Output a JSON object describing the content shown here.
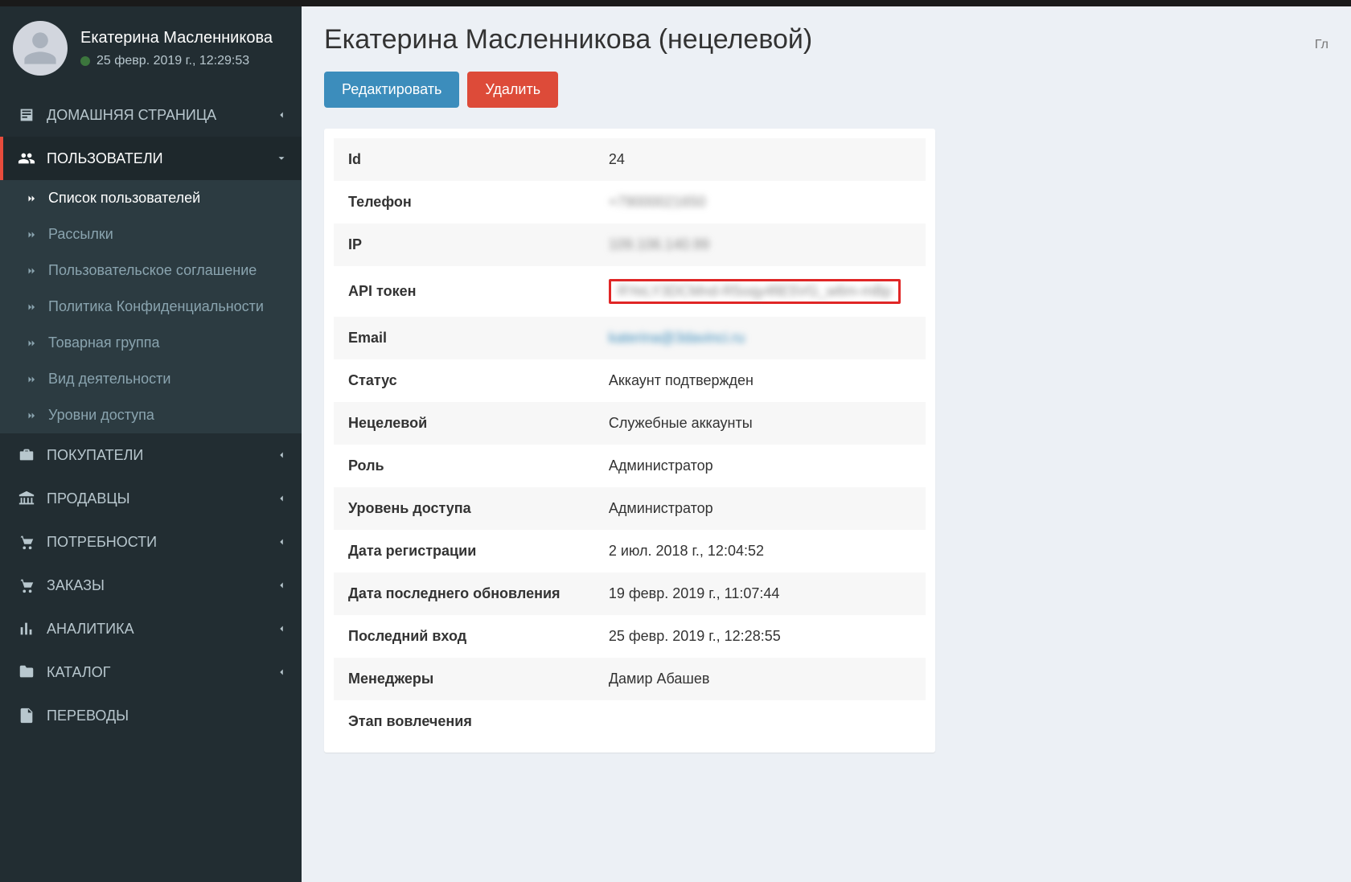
{
  "user_panel": {
    "name": "Екатерина Масленникова",
    "last_login": "25 февр. 2019 г., 12:29:53"
  },
  "nav": {
    "home": "ДОМАШНЯЯ СТРАНИЦА",
    "users": "ПОЛЬЗОВАТЕЛИ",
    "users_children": [
      "Список пользователей",
      "Рассылки",
      "Пользовательское соглашение",
      "Политика Конфиденциальности",
      "Товарная группа",
      "Вид деятельности",
      "Уровни доступа"
    ],
    "buyers": "ПОКУПАТЕЛИ",
    "sellers": "ПРОДАВЦЫ",
    "needs": "ПОТРЕБНОСТИ",
    "orders": "ЗАКАЗЫ",
    "analytics": "АНАЛИТИКА",
    "catalog": "КАТАЛОГ",
    "transfers": "ПЕРЕВОДЫ"
  },
  "page": {
    "title": "Екатерина Масленникова (нецелевой)",
    "breadcrumb": "Гл"
  },
  "actions": {
    "edit": "Редактировать",
    "delete": "Удалить"
  },
  "details": {
    "rows": [
      {
        "key": "Id",
        "value": "24"
      },
      {
        "key": "Телефон",
        "value": "+79000021650",
        "blur": true
      },
      {
        "key": "IP",
        "value": "109.106.140.99",
        "blur": true
      },
      {
        "key": "API токен",
        "value": "RYeLY3DCMnd-R5oqy4fiE5VG_w6m-mBp",
        "blur": true,
        "highlight": true
      },
      {
        "key": "Email",
        "value": "katerina@3davinci.ru",
        "blur": true,
        "link": true
      },
      {
        "key": "Статус",
        "value": "Аккаунт подтвержден"
      },
      {
        "key": "Нецелевой",
        "value": "Служебные аккаунты"
      },
      {
        "key": "Роль",
        "value": "Администратор"
      },
      {
        "key": "Уровень доступа",
        "value": "Администратор"
      },
      {
        "key": "Дата регистрации",
        "value": "2 июл. 2018 г., 12:04:52"
      },
      {
        "key": "Дата последнего обновления",
        "value": "19 февр. 2019 г., 11:07:44"
      },
      {
        "key": "Последний вход",
        "value": "25 февр. 2019 г., 12:28:55"
      },
      {
        "key": "Менеджеры",
        "value": "Дамир Абашев"
      },
      {
        "key": "Этап вовлечения",
        "value": ""
      }
    ]
  }
}
